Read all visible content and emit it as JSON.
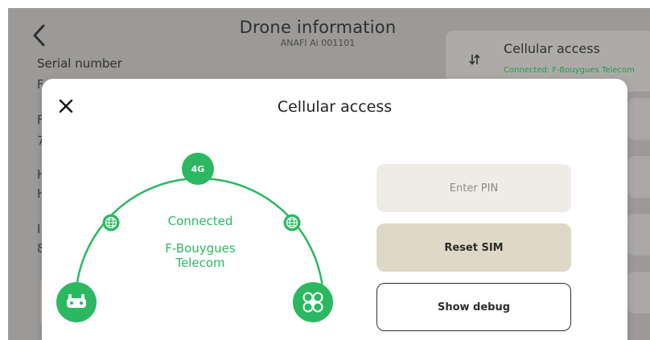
{
  "background_page": {
    "title": "Drone information",
    "subtitle": "ANAFI Ai 001101",
    "serial_label": "Serial number",
    "left_fragments": [
      "F",
      "F",
      "7",
      "H",
      "H",
      "I",
      "8"
    ],
    "cellular_card": {
      "title": "Cellular access",
      "status": "Connected: F-Bouygues Telecom"
    }
  },
  "modal": {
    "title": "Cellular access",
    "diagram": {
      "network_badge": "4G",
      "status": "Connected",
      "carrier_line1": "F-Bouygues",
      "carrier_line2": "Telecom"
    },
    "buttons": {
      "enter_pin": "Enter PIN",
      "reset_sim": "Reset SIM",
      "show_debug": "Show debug"
    }
  },
  "colors": {
    "accent_green": "#2BB860",
    "overlay_gray": "#9C9A98",
    "pin_button_bg": "#EFECE7",
    "reset_button_bg": "#DFD8C7"
  },
  "icons": {
    "back": "chevron-left-icon",
    "close": "close-icon",
    "sort": "sort-arrows-icon",
    "globe": "globe-icon",
    "controller": "controller-icon",
    "drone": "drone-icon"
  }
}
